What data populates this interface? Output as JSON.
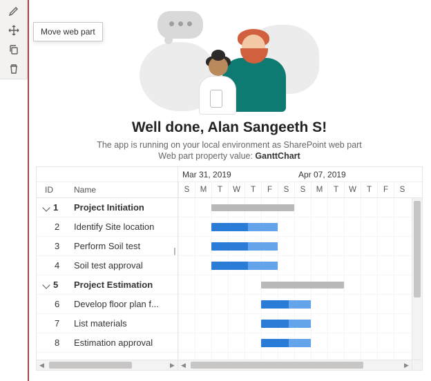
{
  "toolbar": {
    "tooltip_move": "Move web part"
  },
  "hero": {
    "headline": "Well done, Alan Sangeeth S!",
    "subtext": "The app is running on your local environment as SharePoint web part",
    "property_label": "Web part property value: ",
    "property_value": "GanttChart"
  },
  "gantt": {
    "columns": {
      "id": "ID",
      "name": "Name"
    },
    "weeks": [
      {
        "label": "Mar 31, 2019",
        "days": [
          "S",
          "M",
          "T",
          "W",
          "T",
          "F",
          "S"
        ]
      },
      {
        "label": "Apr 07, 2019",
        "days": [
          "S",
          "M",
          "T",
          "W",
          "T",
          "F",
          "S"
        ]
      }
    ],
    "rows": [
      {
        "id": "1",
        "name": "Project Initiation",
        "type": "summary",
        "start": 2,
        "span": 5
      },
      {
        "id": "2",
        "name": "Identify Site location",
        "type": "task",
        "start": 2,
        "span": 4,
        "progress": 0.55
      },
      {
        "id": "3",
        "name": "Perform Soil test",
        "type": "task",
        "start": 2,
        "span": 4,
        "progress": 0.55
      },
      {
        "id": "4",
        "name": "Soil test approval",
        "type": "task",
        "start": 2,
        "span": 4,
        "progress": 0.55
      },
      {
        "id": "5",
        "name": "Project Estimation",
        "type": "summary",
        "start": 5,
        "span": 5
      },
      {
        "id": "6",
        "name": "Develop floor plan f...",
        "type": "task",
        "start": 5,
        "span": 3,
        "progress": 0.55
      },
      {
        "id": "7",
        "name": "List materials",
        "type": "task",
        "start": 5,
        "span": 3,
        "progress": 0.55
      },
      {
        "id": "8",
        "name": "Estimation approval",
        "type": "task",
        "start": 5,
        "span": 3,
        "progress": 0.55
      }
    ]
  }
}
